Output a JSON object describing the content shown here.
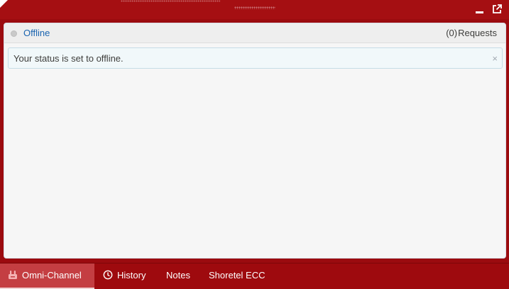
{
  "topbar": {
    "background": "#a50f12",
    "icons": [
      "minimize-icon",
      "popout-icon"
    ]
  },
  "panel": {
    "status": {
      "label": "Offline",
      "dot_color": "#c9c9c9"
    },
    "requests": {
      "count": "(0)",
      "label": "Requests"
    },
    "notice": {
      "text": "Your status is set to offline.",
      "close": "×"
    }
  },
  "tabs": [
    {
      "label": "Omni-Channel",
      "icon": "omni-channel-icon",
      "active": true
    },
    {
      "label": "History",
      "icon": "clock-icon",
      "active": false
    },
    {
      "label": "Notes",
      "icon": "",
      "active": false
    },
    {
      "label": "Shoretel ECC",
      "icon": "",
      "active": false
    }
  ],
  "colors": {
    "brand_red": "#9e0a0e",
    "active_tab": "#c43e42",
    "link_blue": "#1a64b0"
  }
}
